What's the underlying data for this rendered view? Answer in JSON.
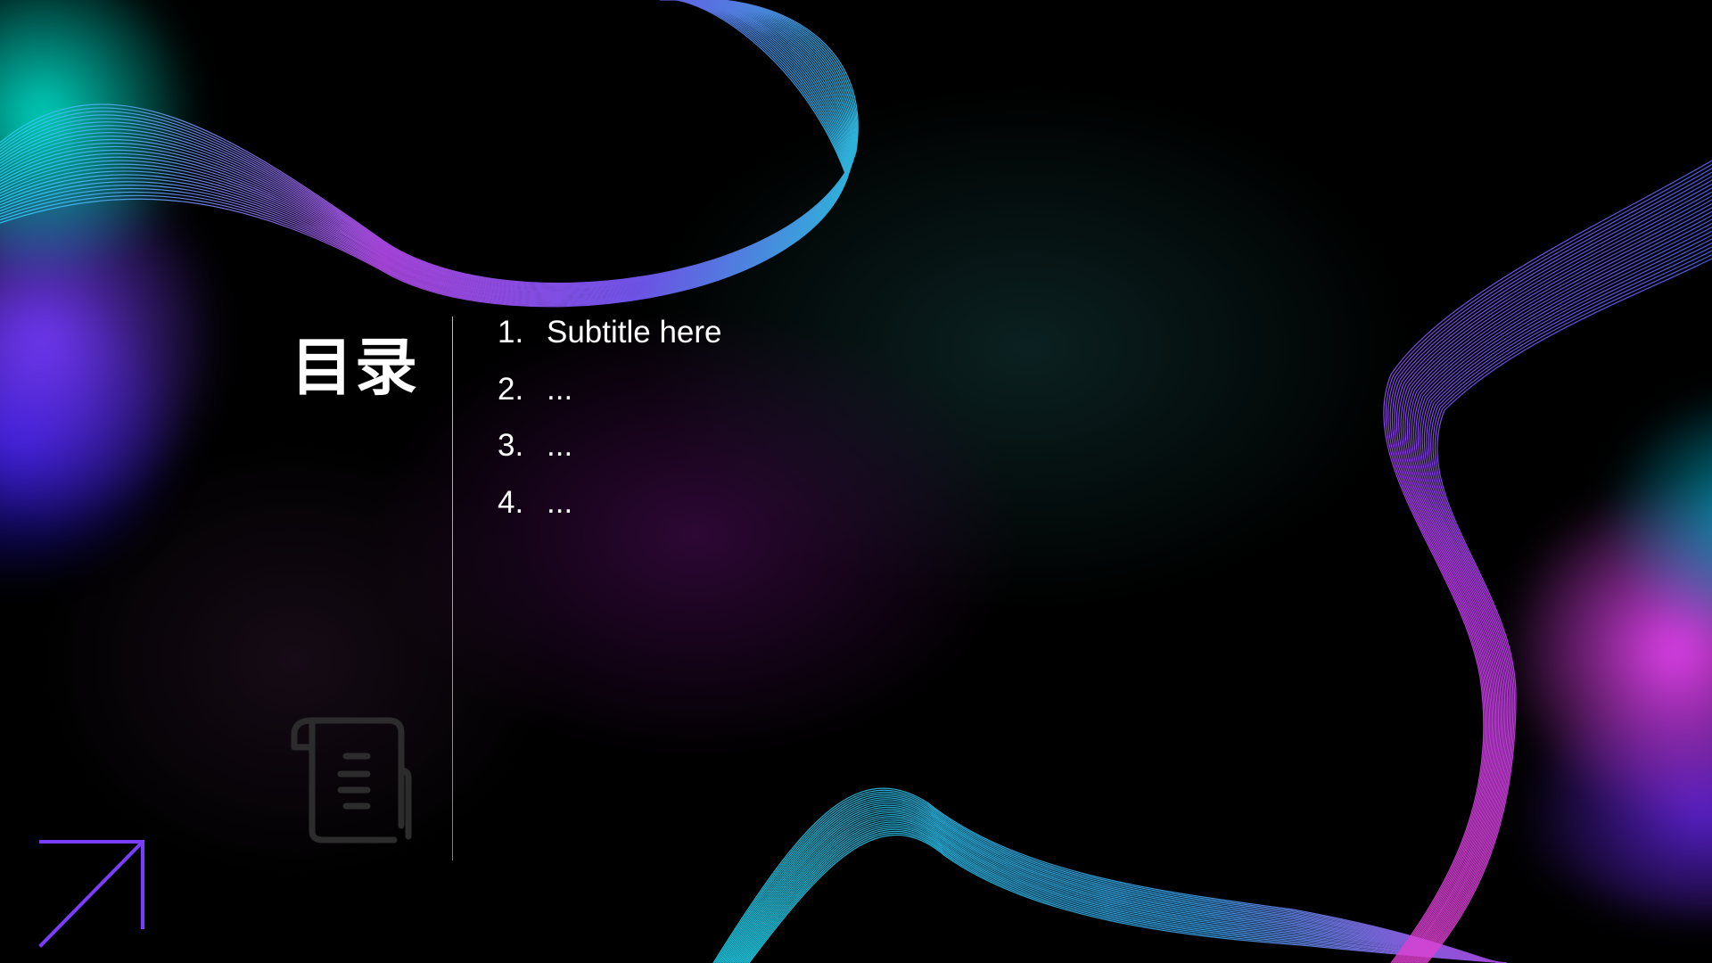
{
  "slide": {
    "title": "目录",
    "toc": [
      {
        "number": "1.",
        "text": "Subtitle here"
      },
      {
        "number": "2.",
        "text": "..."
      },
      {
        "number": "3.",
        "text": "..."
      },
      {
        "number": "4.",
        "text": "..."
      }
    ]
  },
  "icons": {
    "document": "scroll-document-icon",
    "arrow": "arrow-up-right-icon"
  },
  "colors": {
    "background": "#000000",
    "text": "#ffffff",
    "accent_purple": "#7a3cff",
    "wave_cyan": "#22d3ee",
    "wave_magenta": "#d946ef"
  }
}
